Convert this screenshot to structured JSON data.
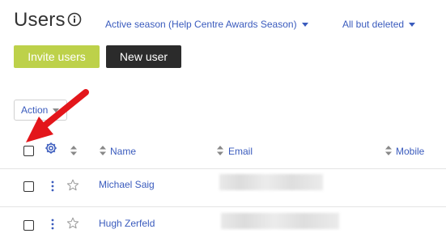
{
  "header": {
    "title": "Users",
    "season_filter": "Active season (Help Centre Awards Season)",
    "status_filter": "All but deleted"
  },
  "buttons": {
    "invite": "Invite users",
    "new_user": "New user"
  },
  "action_dropdown": {
    "label": "Action"
  },
  "table": {
    "columns": {
      "name": "Name",
      "email": "Email",
      "mobile": "Mobile"
    },
    "rows": [
      {
        "name": "Michael Saig",
        "email": "",
        "mobile": ""
      },
      {
        "name": "Hugh Zerfeld",
        "email": "",
        "mobile": ""
      }
    ]
  },
  "colors": {
    "accent_link": "#3a5bbd",
    "invite_button": "#bdd14a",
    "new_button": "#2b2b2b",
    "annotation_arrow": "#e3161b"
  },
  "icons": {
    "info": "info-circle-icon",
    "settings": "gear-icon",
    "sort": "sort-arrows-icon",
    "row_menu": "kebab-menu-icon",
    "favorite": "star-outline-icon",
    "annotation": "red-arrow-icon"
  }
}
